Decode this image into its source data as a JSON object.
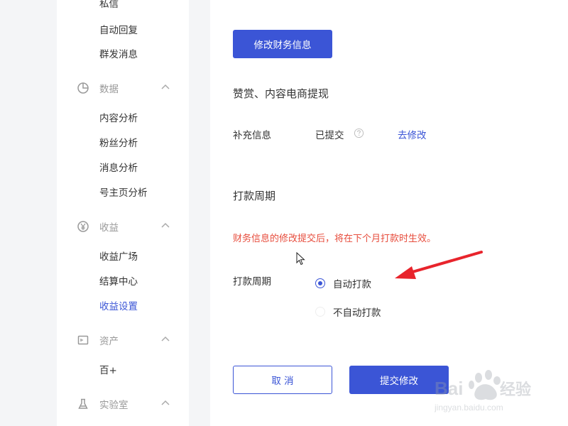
{
  "sidebar": {
    "message_items": [
      "私信",
      "自动回复",
      "群发消息"
    ],
    "groups": {
      "data": {
        "label": "数据",
        "icon": "pie-chart-icon",
        "items": [
          "内容分析",
          "粉丝分析",
          "消息分析",
          "号主页分析"
        ]
      },
      "income": {
        "label": "收益",
        "icon": "yen-icon",
        "items": [
          "收益广场",
          "结算中心",
          "收益设置"
        ],
        "active_item": "收益设置"
      },
      "assets": {
        "label": "资产",
        "icon": "wallet-icon",
        "items": [
          "百+"
        ]
      },
      "lab": {
        "label": "实验室",
        "icon": "flask-icon",
        "items": []
      }
    }
  },
  "main": {
    "edit_finance_button": "修改财务信息",
    "reward_section_title": "赞赏、内容电商提现",
    "supplement_label": "补充信息",
    "supplement_status": "已提交",
    "supplement_link": "去修改",
    "payout_section_title": "打款周期",
    "warning_text": "财务信息的修改提交后，将在下个月打款时生效。",
    "payout_label": "打款周期",
    "radio_options": [
      {
        "label": "自动打款",
        "checked": true
      },
      {
        "label": "不自动打款",
        "checked": false
      }
    ],
    "cancel_button": "取 消",
    "submit_button": "提交修改"
  },
  "colors": {
    "accent": "#3b55d6",
    "warning": "#e74c3c",
    "annotation_arrow": "#e8242c"
  },
  "watermark": {
    "logo": "Bai du 经验",
    "url": "jingyan.baidu.com"
  }
}
